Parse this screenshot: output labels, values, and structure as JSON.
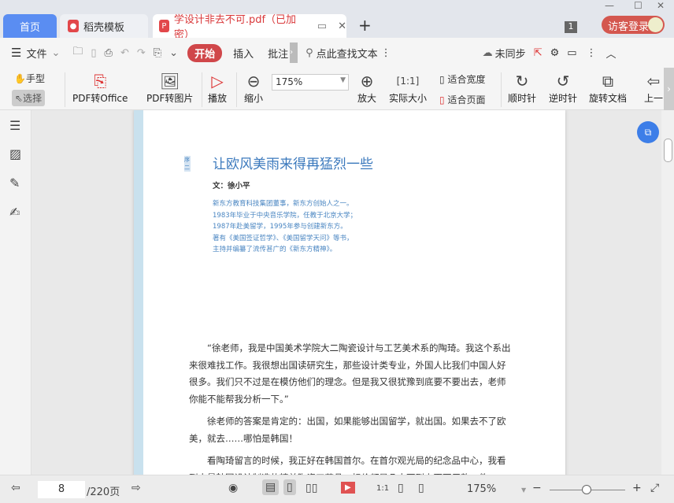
{
  "tabs": {
    "home": "首页",
    "template": "稻壳模板",
    "document": "学设计非去不可.pdf（已加密）",
    "new_tab": "+",
    "badge": "1",
    "login": "访客登录"
  },
  "window": {
    "minimize": "—",
    "maximize": "☐",
    "close": "✕"
  },
  "menu": {
    "file": "文件",
    "start": "开始",
    "insert": "插入",
    "annotate": "批注",
    "search": "点此查找文本",
    "sync": "未同步"
  },
  "toolbar": {
    "hand": "手型",
    "select": "选择",
    "pdf_to_office": "PDF转Office",
    "pdf_to_image": "PDF转图片",
    "play": "播放",
    "zoom_out": "缩小",
    "zoom_value": "175%",
    "zoom_in": "放大",
    "actual_size": "实际大小",
    "fit_width": "适合宽度",
    "fit_page": "适合页面",
    "clockwise": "顺时针",
    "counterclockwise": "逆时针",
    "rotate_doc": "旋转文档",
    "prev": "上一"
  },
  "document": {
    "section": "序二",
    "title": "让欧风美雨来得再猛烈一些",
    "author": "文：徐小平",
    "bio": [
      "新东方教育科技集团董事，新东方创始人之一。",
      "1983年毕业于中央音乐学院，任教于北京大学；",
      "1987年赴美留学，1995年参与创建新东方。",
      "著有《美国签证哲学》、《美国留学天问》等书，",
      "主持并编纂了流传甚广的《新东方精神》。"
    ],
    "paragraphs": [
      "“徐老师，我是中国美术学院大二陶瓷设计与工艺美术系的陶琦。我这个系出来很难找工作。我很想出国读研究生，那些设计类专业，外国人比我们中国人好很多。我们只不过是在模仿他们的理念。但是我又很犹豫到底要不要出去，老师你能不能帮我分析一下。”",
      "徐老师的答案是肯定的：出国，如果能够出国留学，就出国。如果去不了欧美，就去……哪怕是韩国！",
      "看陶琦留言的时候，我正好在韩国首尔。在首尔观光局的纪念品中心，我看到大量韩国设计制造的精美陶瓷工艺品，标价都是几十万到上百万巨款一件——不要"
    ]
  },
  "status": {
    "page": "8",
    "total": "/220页",
    "zoom": "175%"
  }
}
